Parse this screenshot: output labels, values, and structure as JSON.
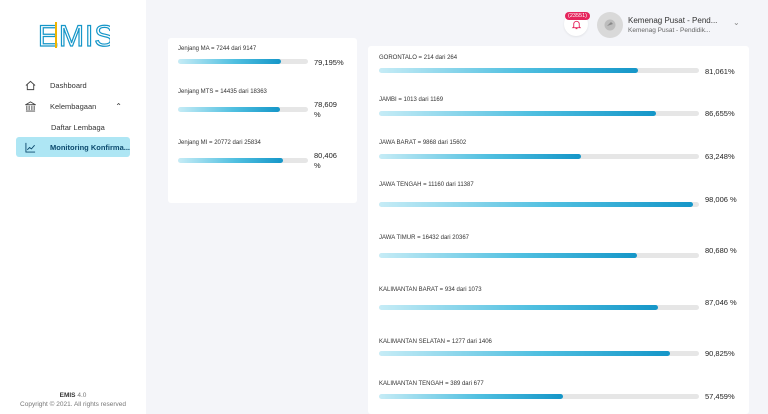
{
  "brand": {
    "logo_text": "EMIS",
    "colors": {
      "primary": "#1596c8",
      "accent": "#f0b400",
      "badge": "#e5245c"
    }
  },
  "sidebar": {
    "items": [
      {
        "label": "Dashboard",
        "icon": "home-icon"
      },
      {
        "label": "Kelembagaan",
        "icon": "institution-icon"
      },
      {
        "label": "Daftar Lembaga"
      },
      {
        "label": "Monitoring Konfirma...",
        "icon": "chart-line-icon"
      }
    ],
    "footer": {
      "app": "EMIS",
      "version": "4.0",
      "copyright": "Copyright © 2021. All rights reserved"
    }
  },
  "topbar": {
    "notification_count": "(23551)",
    "user_name": "Kemenag Pusat - Pend...",
    "user_role": "Kemenag Pusat - Pendidik..."
  },
  "jenjang": [
    {
      "label": "Jenjang MA = 7244 dari 9147",
      "pct_text": "79,195%",
      "value": 0.79195
    },
    {
      "label": "Jenjang MTS = 14435 dari 18363",
      "pct_text": "78,609 %",
      "value": 0.78609
    },
    {
      "label": "Jenjang MI = 20772 dari 25834",
      "pct_text": "80,406 %",
      "value": 0.80406
    }
  ],
  "provinsi": [
    {
      "label": "GORONTALO = 214 dari 264",
      "pct_text": "81,061%",
      "value": 0.81061
    },
    {
      "label": "JAMBI = 1013 dari 1169",
      "pct_text": "86,655%",
      "value": 0.86655
    },
    {
      "label": "JAWA BARAT = 9868 dari 15602",
      "pct_text": "63,248%",
      "value": 0.63248
    },
    {
      "label": "JAWA TENGAH = 11160 dari 11387",
      "pct_text": "98,006 %",
      "value": 0.98006
    },
    {
      "label": "JAWA TIMUR = 16432 dari 20367",
      "pct_text": "80,680 %",
      "value": 0.8068
    },
    {
      "label": "KALIMANTAN BARAT = 934 dari 1073",
      "pct_text": "87,046 %",
      "value": 0.87046
    },
    {
      "label": "KALIMANTAN SELATAN = 1277 dari 1406",
      "pct_text": "90,825%",
      "value": 0.90825
    },
    {
      "label": "KALIMANTAN TENGAH = 389 dari 677",
      "pct_text": "57,459%",
      "value": 0.57459
    }
  ]
}
